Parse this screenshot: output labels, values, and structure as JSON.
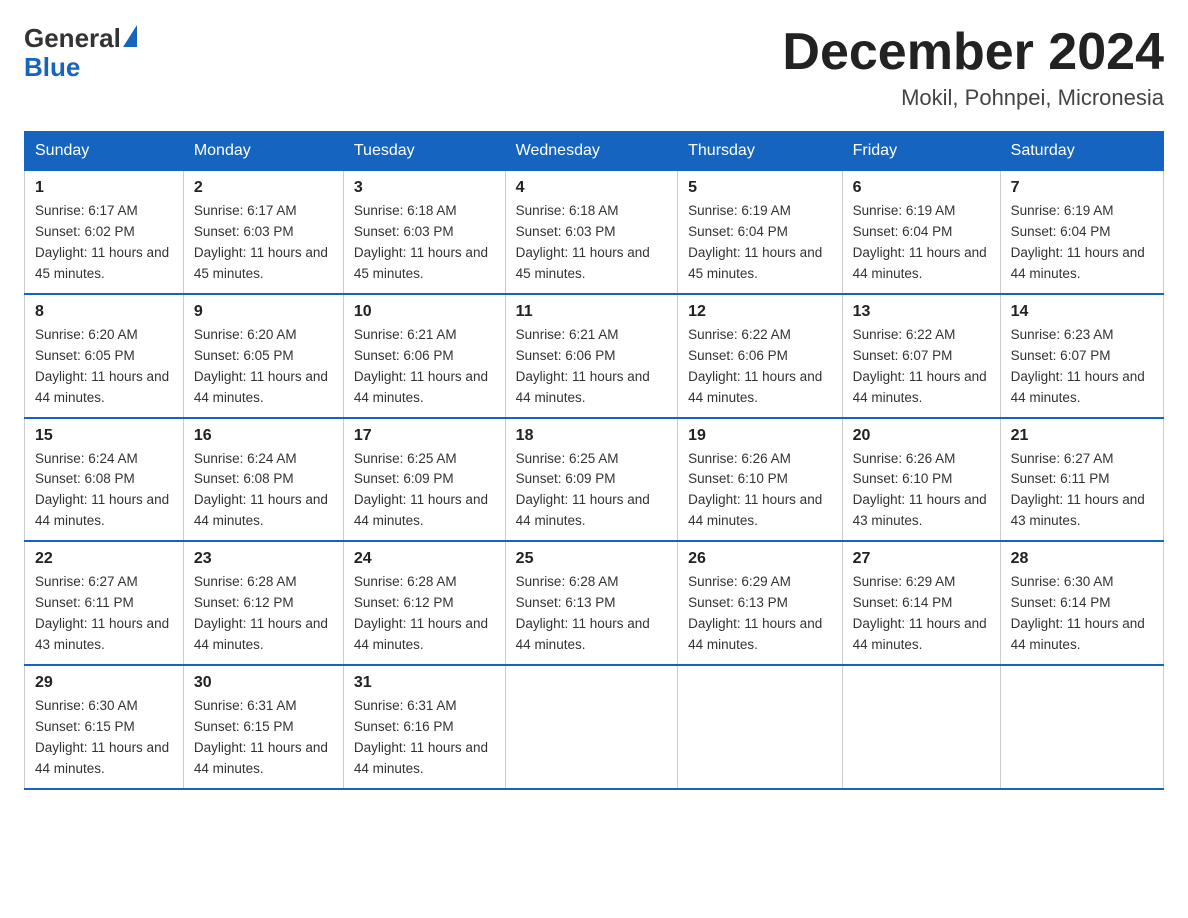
{
  "logo": {
    "general": "General",
    "blue": "Blue"
  },
  "title": "December 2024",
  "subtitle": "Mokil, Pohnpei, Micronesia",
  "days_of_week": [
    "Sunday",
    "Monday",
    "Tuesday",
    "Wednesday",
    "Thursday",
    "Friday",
    "Saturday"
  ],
  "weeks": [
    [
      {
        "day": "1",
        "sunrise": "6:17 AM",
        "sunset": "6:02 PM",
        "daylight": "11 hours and 45 minutes."
      },
      {
        "day": "2",
        "sunrise": "6:17 AM",
        "sunset": "6:03 PM",
        "daylight": "11 hours and 45 minutes."
      },
      {
        "day": "3",
        "sunrise": "6:18 AM",
        "sunset": "6:03 PM",
        "daylight": "11 hours and 45 minutes."
      },
      {
        "day": "4",
        "sunrise": "6:18 AM",
        "sunset": "6:03 PM",
        "daylight": "11 hours and 45 minutes."
      },
      {
        "day": "5",
        "sunrise": "6:19 AM",
        "sunset": "6:04 PM",
        "daylight": "11 hours and 45 minutes."
      },
      {
        "day": "6",
        "sunrise": "6:19 AM",
        "sunset": "6:04 PM",
        "daylight": "11 hours and 44 minutes."
      },
      {
        "day": "7",
        "sunrise": "6:19 AM",
        "sunset": "6:04 PM",
        "daylight": "11 hours and 44 minutes."
      }
    ],
    [
      {
        "day": "8",
        "sunrise": "6:20 AM",
        "sunset": "6:05 PM",
        "daylight": "11 hours and 44 minutes."
      },
      {
        "day": "9",
        "sunrise": "6:20 AM",
        "sunset": "6:05 PM",
        "daylight": "11 hours and 44 minutes."
      },
      {
        "day": "10",
        "sunrise": "6:21 AM",
        "sunset": "6:06 PM",
        "daylight": "11 hours and 44 minutes."
      },
      {
        "day": "11",
        "sunrise": "6:21 AM",
        "sunset": "6:06 PM",
        "daylight": "11 hours and 44 minutes."
      },
      {
        "day": "12",
        "sunrise": "6:22 AM",
        "sunset": "6:06 PM",
        "daylight": "11 hours and 44 minutes."
      },
      {
        "day": "13",
        "sunrise": "6:22 AM",
        "sunset": "6:07 PM",
        "daylight": "11 hours and 44 minutes."
      },
      {
        "day": "14",
        "sunrise": "6:23 AM",
        "sunset": "6:07 PM",
        "daylight": "11 hours and 44 minutes."
      }
    ],
    [
      {
        "day": "15",
        "sunrise": "6:24 AM",
        "sunset": "6:08 PM",
        "daylight": "11 hours and 44 minutes."
      },
      {
        "day": "16",
        "sunrise": "6:24 AM",
        "sunset": "6:08 PM",
        "daylight": "11 hours and 44 minutes."
      },
      {
        "day": "17",
        "sunrise": "6:25 AM",
        "sunset": "6:09 PM",
        "daylight": "11 hours and 44 minutes."
      },
      {
        "day": "18",
        "sunrise": "6:25 AM",
        "sunset": "6:09 PM",
        "daylight": "11 hours and 44 minutes."
      },
      {
        "day": "19",
        "sunrise": "6:26 AM",
        "sunset": "6:10 PM",
        "daylight": "11 hours and 44 minutes."
      },
      {
        "day": "20",
        "sunrise": "6:26 AM",
        "sunset": "6:10 PM",
        "daylight": "11 hours and 43 minutes."
      },
      {
        "day": "21",
        "sunrise": "6:27 AM",
        "sunset": "6:11 PM",
        "daylight": "11 hours and 43 minutes."
      }
    ],
    [
      {
        "day": "22",
        "sunrise": "6:27 AM",
        "sunset": "6:11 PM",
        "daylight": "11 hours and 43 minutes."
      },
      {
        "day": "23",
        "sunrise": "6:28 AM",
        "sunset": "6:12 PM",
        "daylight": "11 hours and 44 minutes."
      },
      {
        "day": "24",
        "sunrise": "6:28 AM",
        "sunset": "6:12 PM",
        "daylight": "11 hours and 44 minutes."
      },
      {
        "day": "25",
        "sunrise": "6:28 AM",
        "sunset": "6:13 PM",
        "daylight": "11 hours and 44 minutes."
      },
      {
        "day": "26",
        "sunrise": "6:29 AM",
        "sunset": "6:13 PM",
        "daylight": "11 hours and 44 minutes."
      },
      {
        "day": "27",
        "sunrise": "6:29 AM",
        "sunset": "6:14 PM",
        "daylight": "11 hours and 44 minutes."
      },
      {
        "day": "28",
        "sunrise": "6:30 AM",
        "sunset": "6:14 PM",
        "daylight": "11 hours and 44 minutes."
      }
    ],
    [
      {
        "day": "29",
        "sunrise": "6:30 AM",
        "sunset": "6:15 PM",
        "daylight": "11 hours and 44 minutes."
      },
      {
        "day": "30",
        "sunrise": "6:31 AM",
        "sunset": "6:15 PM",
        "daylight": "11 hours and 44 minutes."
      },
      {
        "day": "31",
        "sunrise": "6:31 AM",
        "sunset": "6:16 PM",
        "daylight": "11 hours and 44 minutes."
      },
      {
        "day": "",
        "sunrise": "",
        "sunset": "",
        "daylight": ""
      },
      {
        "day": "",
        "sunrise": "",
        "sunset": "",
        "daylight": ""
      },
      {
        "day": "",
        "sunrise": "",
        "sunset": "",
        "daylight": ""
      },
      {
        "day": "",
        "sunrise": "",
        "sunset": "",
        "daylight": ""
      }
    ]
  ]
}
